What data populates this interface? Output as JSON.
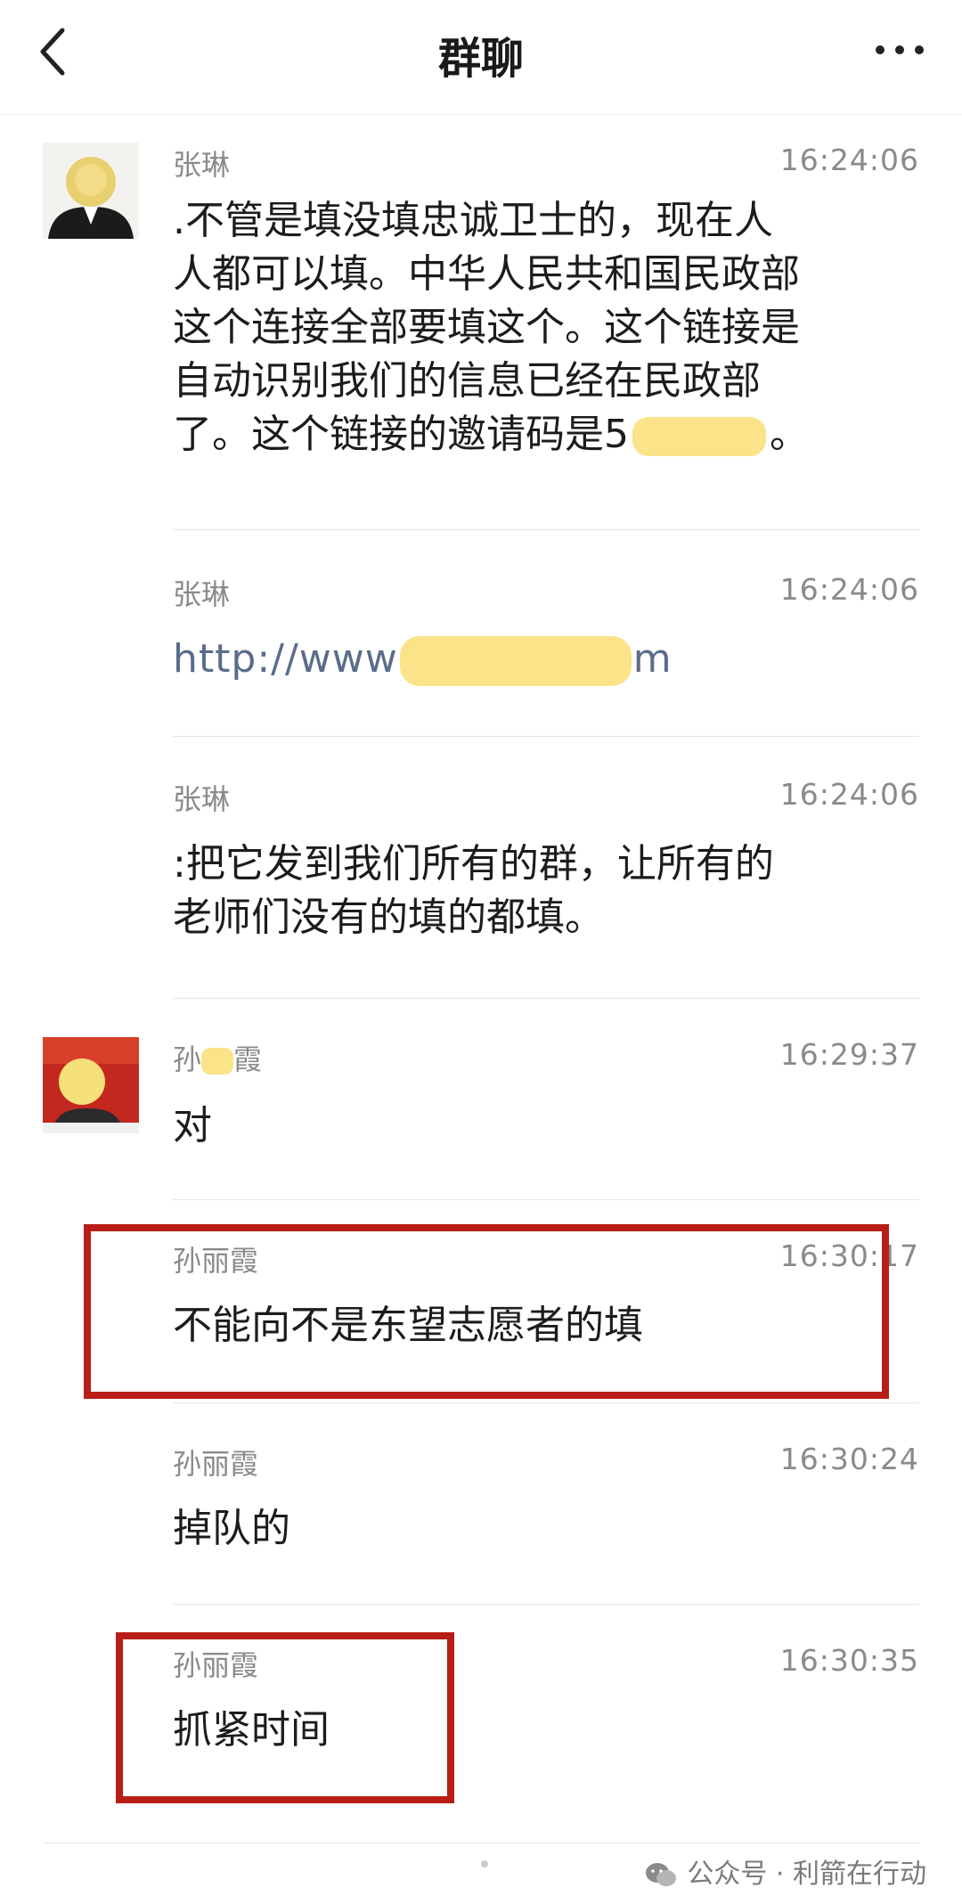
{
  "header": {
    "title": "群聊"
  },
  "messages": [
    {
      "sender": "张琳",
      "time": "16:24:06",
      "lines": [
        ".不管是填没填忠诚卫士的，现在人",
        "人都可以填。中华人民共和国民政部",
        "这个连接全部要填这个。这个链接是",
        "自动识别我们的信息已经在民政部",
        "了。这个链接的邀请码是5"
      ],
      "tail": "。"
    },
    {
      "sender": "张琳",
      "time": "16:24:06",
      "link_start": "http://www",
      "link_end": "m"
    },
    {
      "sender": "张琳",
      "time": "16:24:06",
      "lines": [
        ":把它发到我们所有的群，让所有的",
        "老师们没有的填的都填。"
      ]
    },
    {
      "sender": "孙丽霞",
      "sender_visible": "孙",
      "sender_tail": "霞",
      "time": "16:29:37",
      "text": "对"
    },
    {
      "sender": "孙丽霞",
      "time": "16:30:17",
      "text": "不能向不是东望志愿者的填"
    },
    {
      "sender": "孙丽霞",
      "time": "16:30:24",
      "text": "掉队的"
    },
    {
      "sender": "孙丽霞",
      "time": "16:30:35",
      "text": "抓紧时间"
    }
  ],
  "footer": {
    "source": "公众号 · 利箭在行动"
  },
  "colors": {
    "highlight": "#b91d17",
    "redaction": "#fbe38a",
    "link": "#5a6c8a"
  }
}
